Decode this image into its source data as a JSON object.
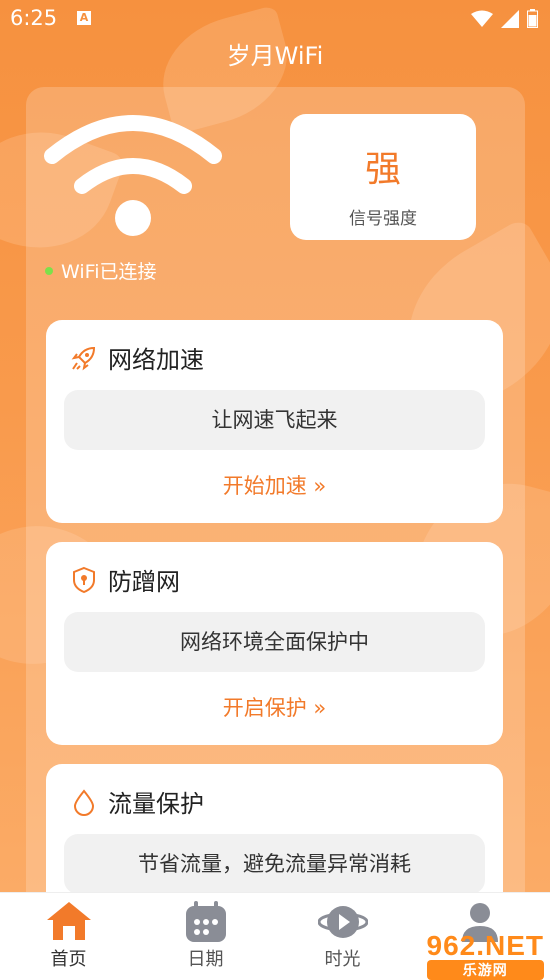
{
  "status_bar": {
    "time": "6:25",
    "notification_badge": "A"
  },
  "app": {
    "title": "岁月WiFi"
  },
  "wifi": {
    "status_text": "WiFi已连接",
    "status_color": "#7de04a"
  },
  "signal": {
    "value": "强",
    "label": "信号强度"
  },
  "cards": [
    {
      "title": "网络加速",
      "icon": "rocket-icon",
      "description": "让网速飞起来",
      "action": "开始加速 »"
    },
    {
      "title": "防蹭网",
      "icon": "shield-icon",
      "description": "网络环境全面保护中",
      "action": "开启保护 »"
    },
    {
      "title": "流量保护",
      "icon": "water-drop-icon",
      "description": "节省流量，避免流量异常消耗",
      "action": ""
    }
  ],
  "tabs": [
    {
      "label": "首页",
      "icon": "home-icon",
      "active": true
    },
    {
      "label": "日期",
      "icon": "calendar-icon",
      "active": false
    },
    {
      "label": "时光",
      "icon": "planet-play-icon",
      "active": false
    },
    {
      "label": "",
      "icon": "user-icon",
      "active": false
    }
  ],
  "watermark": {
    "text": "962.NET",
    "subtext": "乐游网"
  },
  "colors": {
    "accent": "#f27a2a",
    "background_top": "#f6913f"
  }
}
